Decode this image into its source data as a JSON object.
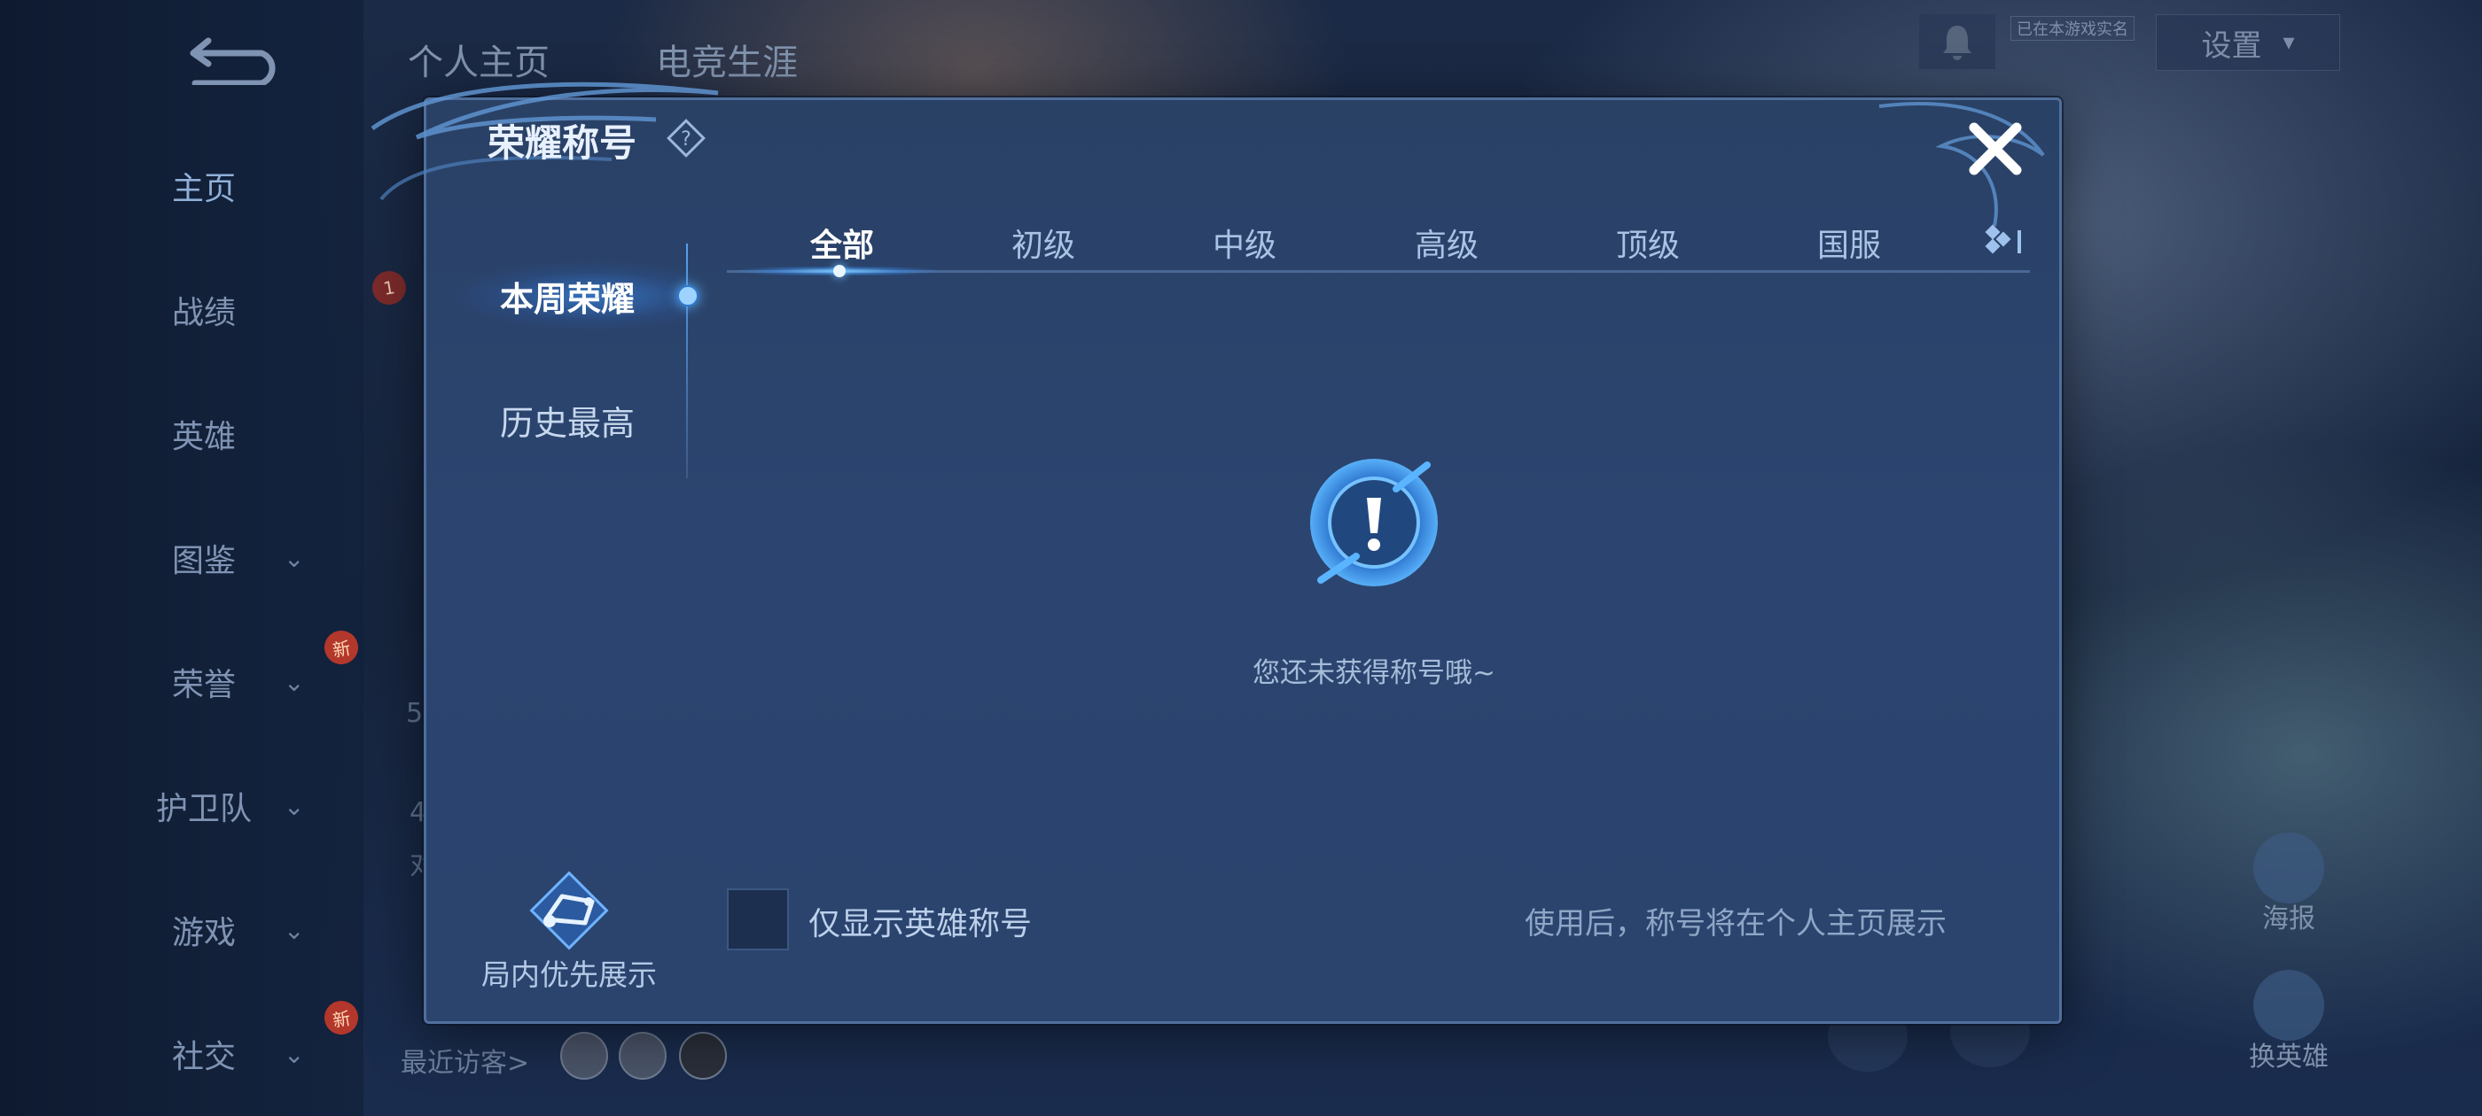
{
  "background": {
    "top_tabs": [
      "个人主页",
      "电竞生涯"
    ],
    "settings_label": "设置",
    "tiny_tag": "已在本游戏实名",
    "sidebar": [
      {
        "label": "主页",
        "chevron": false,
        "new": false
      },
      {
        "label": "战绩",
        "chevron": false,
        "new": false
      },
      {
        "label": "英雄",
        "chevron": false,
        "new": false
      },
      {
        "label": "图鉴",
        "chevron": true,
        "new": false
      },
      {
        "label": "荣誉",
        "chevron": true,
        "new": true
      },
      {
        "label": "护卫队",
        "chevron": true,
        "new": false
      },
      {
        "label": "游戏",
        "chevron": true,
        "new": false
      },
      {
        "label": "社交",
        "chevron": true,
        "new": true
      }
    ],
    "new_badge": "新",
    "rank_badge": "1",
    "visitors_label": "最近访客>",
    "right_buttons": [
      "海报",
      "换英雄"
    ],
    "partial_text": [
      "5",
      "4",
      "对"
    ]
  },
  "modal": {
    "title": "荣耀称号",
    "left_tabs": [
      {
        "label": "本周荣耀",
        "active": true
      },
      {
        "label": "历史最高",
        "active": false
      }
    ],
    "top_tabs": [
      {
        "label": "全部",
        "active": true
      },
      {
        "label": "初级",
        "active": false
      },
      {
        "label": "中级",
        "active": false
      },
      {
        "label": "高级",
        "active": false
      },
      {
        "label": "顶级",
        "active": false
      },
      {
        "label": "国服",
        "active": false
      }
    ],
    "empty_message": "您还未获得称号哦~",
    "checkbox_label": "仅显示英雄称号",
    "checkbox_checked": false,
    "hint_text": "使用后，称号将在个人主页展示",
    "priority_label": "局内优先展示"
  },
  "colors": {
    "accent": "#5ab4ff",
    "modal_bg": "#2b4570",
    "new_badge": "#b3372b"
  }
}
